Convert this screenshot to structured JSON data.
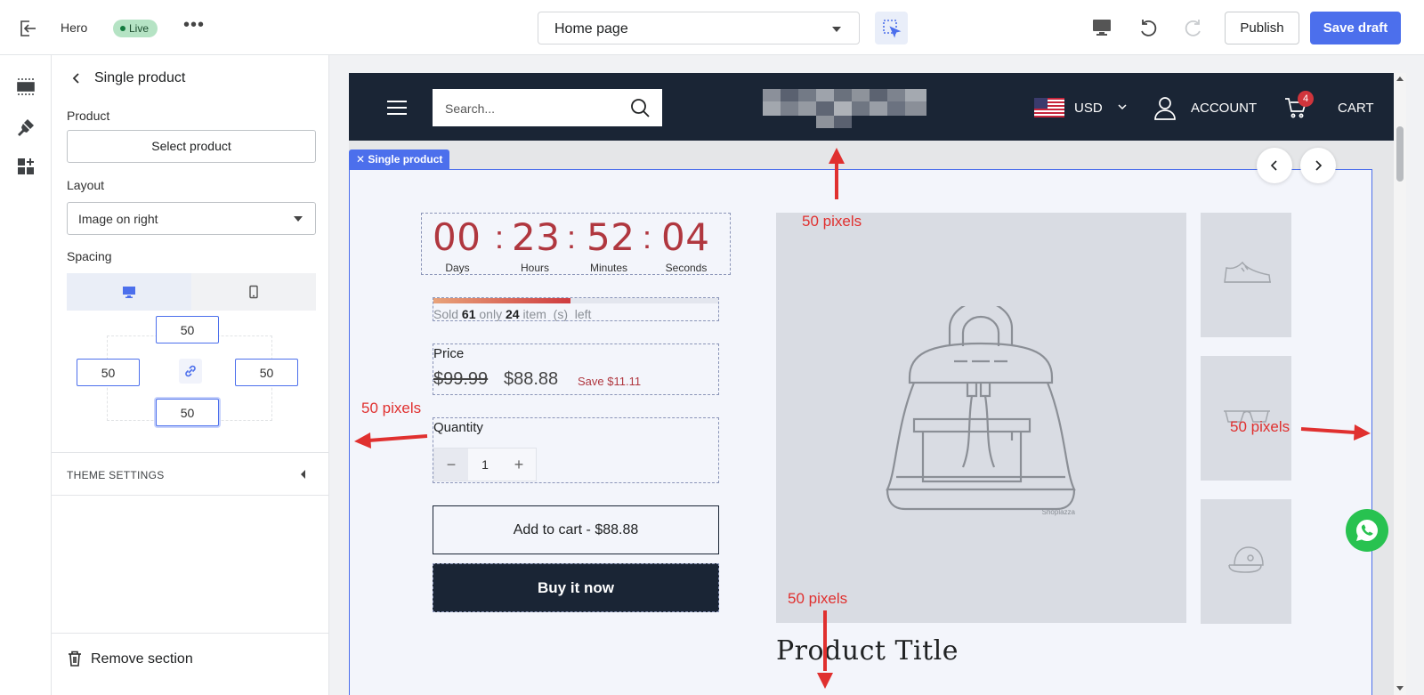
{
  "topbar": {
    "exit_icon": "exit-icon",
    "section_name": "Hero",
    "status": "Live",
    "more": "•••",
    "page_select_value": "Home page",
    "publish_label": "Publish",
    "save_draft_label": "Save draft",
    "accent": "#4c6fec"
  },
  "rail": {
    "items": [
      "sections-icon",
      "theme-brush-icon",
      "apps-icon"
    ]
  },
  "panel": {
    "title": "Single product",
    "product_label": "Product",
    "select_product_label": "Select product",
    "layout_label": "Layout",
    "layout_value": "Image on right",
    "spacing_label": "Spacing",
    "spacing": {
      "top": "50",
      "left": "50",
      "right": "50",
      "bottom": "50"
    },
    "theme_settings_label": "THEME SETTINGS",
    "remove_section_label": "Remove section"
  },
  "store": {
    "search_placeholder": "Search...",
    "currency": "USD",
    "account_label": "ACCOUNT",
    "cart_label": "CART",
    "cart_count": "4",
    "header_bg": "#1a2535"
  },
  "section": {
    "tag_label": "Single product",
    "countdown": {
      "days": "00",
      "hours": "23",
      "minutes": "52",
      "seconds": "04",
      "days_label": "Days",
      "hours_label": "Hours",
      "minutes_label": "Minutes",
      "seconds_label": "Seconds"
    },
    "sold": {
      "sold_count": "61",
      "left_count": "24",
      "prefix": "Sold",
      "middle": "only",
      "suffix": "item  (s)  left",
      "progress_fraction": 0.48
    },
    "price_label": "Price",
    "price_old": "$99.99",
    "price_new": "$88.88",
    "price_save": "Save $11.11",
    "quantity_label": "Quantity",
    "quantity_value": "1",
    "add_to_cart_label": "Add to cart - $88.88",
    "buy_now_label": "Buy it now",
    "image_brand": "Shoplazza",
    "thumbnails": [
      "sneaker-icon",
      "glasses-icon",
      "cap-icon"
    ],
    "product_title": "Product Title"
  },
  "annotations": {
    "top": "50 pixels",
    "left": "50 pixels",
    "right": "50 pixels",
    "bottom": "50 pixels",
    "color": "#e0302f"
  }
}
